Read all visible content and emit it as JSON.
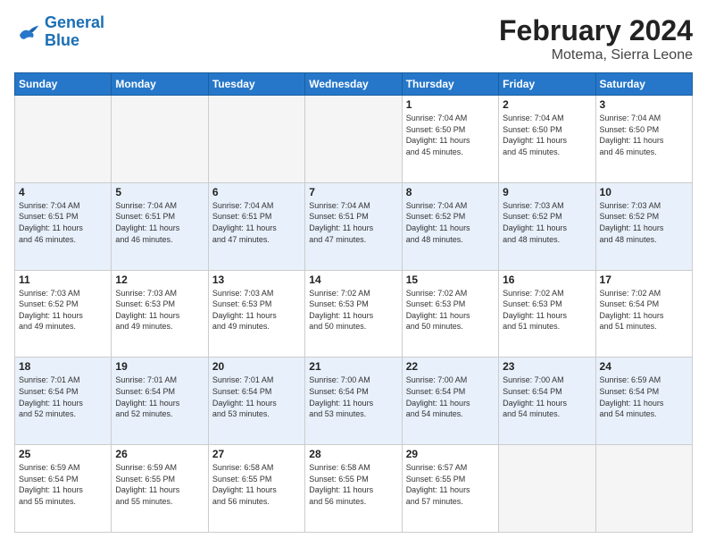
{
  "header": {
    "logo_line1": "General",
    "logo_line2": "Blue",
    "month_title": "February 2024",
    "location": "Motema, Sierra Leone"
  },
  "weekdays": [
    "Sunday",
    "Monday",
    "Tuesday",
    "Wednesday",
    "Thursday",
    "Friday",
    "Saturday"
  ],
  "weeks": [
    [
      {
        "day": "",
        "info": ""
      },
      {
        "day": "",
        "info": ""
      },
      {
        "day": "",
        "info": ""
      },
      {
        "day": "",
        "info": ""
      },
      {
        "day": "1",
        "info": "Sunrise: 7:04 AM\nSunset: 6:50 PM\nDaylight: 11 hours\nand 45 minutes."
      },
      {
        "day": "2",
        "info": "Sunrise: 7:04 AM\nSunset: 6:50 PM\nDaylight: 11 hours\nand 45 minutes."
      },
      {
        "day": "3",
        "info": "Sunrise: 7:04 AM\nSunset: 6:50 PM\nDaylight: 11 hours\nand 46 minutes."
      }
    ],
    [
      {
        "day": "4",
        "info": "Sunrise: 7:04 AM\nSunset: 6:51 PM\nDaylight: 11 hours\nand 46 minutes."
      },
      {
        "day": "5",
        "info": "Sunrise: 7:04 AM\nSunset: 6:51 PM\nDaylight: 11 hours\nand 46 minutes."
      },
      {
        "day": "6",
        "info": "Sunrise: 7:04 AM\nSunset: 6:51 PM\nDaylight: 11 hours\nand 47 minutes."
      },
      {
        "day": "7",
        "info": "Sunrise: 7:04 AM\nSunset: 6:51 PM\nDaylight: 11 hours\nand 47 minutes."
      },
      {
        "day": "8",
        "info": "Sunrise: 7:04 AM\nSunset: 6:52 PM\nDaylight: 11 hours\nand 48 minutes."
      },
      {
        "day": "9",
        "info": "Sunrise: 7:03 AM\nSunset: 6:52 PM\nDaylight: 11 hours\nand 48 minutes."
      },
      {
        "day": "10",
        "info": "Sunrise: 7:03 AM\nSunset: 6:52 PM\nDaylight: 11 hours\nand 48 minutes."
      }
    ],
    [
      {
        "day": "11",
        "info": "Sunrise: 7:03 AM\nSunset: 6:52 PM\nDaylight: 11 hours\nand 49 minutes."
      },
      {
        "day": "12",
        "info": "Sunrise: 7:03 AM\nSunset: 6:53 PM\nDaylight: 11 hours\nand 49 minutes."
      },
      {
        "day": "13",
        "info": "Sunrise: 7:03 AM\nSunset: 6:53 PM\nDaylight: 11 hours\nand 49 minutes."
      },
      {
        "day": "14",
        "info": "Sunrise: 7:02 AM\nSunset: 6:53 PM\nDaylight: 11 hours\nand 50 minutes."
      },
      {
        "day": "15",
        "info": "Sunrise: 7:02 AM\nSunset: 6:53 PM\nDaylight: 11 hours\nand 50 minutes."
      },
      {
        "day": "16",
        "info": "Sunrise: 7:02 AM\nSunset: 6:53 PM\nDaylight: 11 hours\nand 51 minutes."
      },
      {
        "day": "17",
        "info": "Sunrise: 7:02 AM\nSunset: 6:54 PM\nDaylight: 11 hours\nand 51 minutes."
      }
    ],
    [
      {
        "day": "18",
        "info": "Sunrise: 7:01 AM\nSunset: 6:54 PM\nDaylight: 11 hours\nand 52 minutes."
      },
      {
        "day": "19",
        "info": "Sunrise: 7:01 AM\nSunset: 6:54 PM\nDaylight: 11 hours\nand 52 minutes."
      },
      {
        "day": "20",
        "info": "Sunrise: 7:01 AM\nSunset: 6:54 PM\nDaylight: 11 hours\nand 53 minutes."
      },
      {
        "day": "21",
        "info": "Sunrise: 7:00 AM\nSunset: 6:54 PM\nDaylight: 11 hours\nand 53 minutes."
      },
      {
        "day": "22",
        "info": "Sunrise: 7:00 AM\nSunset: 6:54 PM\nDaylight: 11 hours\nand 54 minutes."
      },
      {
        "day": "23",
        "info": "Sunrise: 7:00 AM\nSunset: 6:54 PM\nDaylight: 11 hours\nand 54 minutes."
      },
      {
        "day": "24",
        "info": "Sunrise: 6:59 AM\nSunset: 6:54 PM\nDaylight: 11 hours\nand 54 minutes."
      }
    ],
    [
      {
        "day": "25",
        "info": "Sunrise: 6:59 AM\nSunset: 6:54 PM\nDaylight: 11 hours\nand 55 minutes."
      },
      {
        "day": "26",
        "info": "Sunrise: 6:59 AM\nSunset: 6:55 PM\nDaylight: 11 hours\nand 55 minutes."
      },
      {
        "day": "27",
        "info": "Sunrise: 6:58 AM\nSunset: 6:55 PM\nDaylight: 11 hours\nand 56 minutes."
      },
      {
        "day": "28",
        "info": "Sunrise: 6:58 AM\nSunset: 6:55 PM\nDaylight: 11 hours\nand 56 minutes."
      },
      {
        "day": "29",
        "info": "Sunrise: 6:57 AM\nSunset: 6:55 PM\nDaylight: 11 hours\nand 57 minutes."
      },
      {
        "day": "",
        "info": ""
      },
      {
        "day": "",
        "info": ""
      }
    ]
  ]
}
